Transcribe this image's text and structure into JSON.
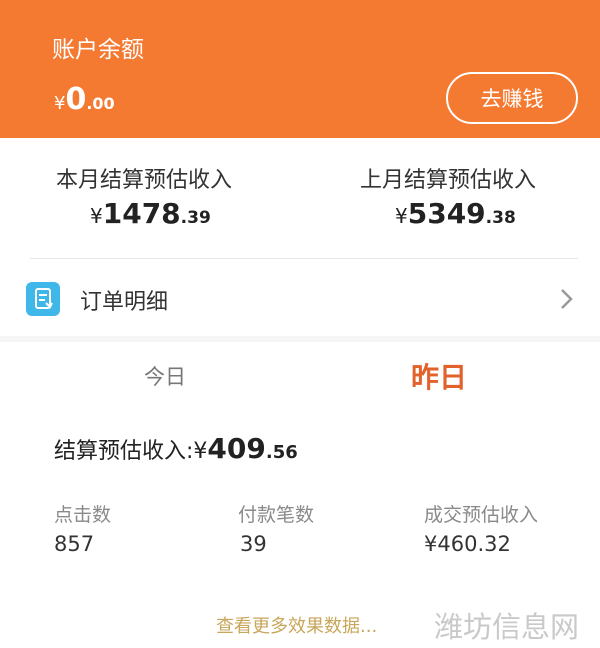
{
  "account": {
    "title": "账户余额",
    "currency": "¥",
    "amount_int": "0",
    "amount_dec": ".00",
    "earn_button": "去赚钱"
  },
  "monthly": {
    "this_month": {
      "label": "本月结算预估收入",
      "currency": "¥",
      "int": "1478",
      "dec": ".39"
    },
    "last_month": {
      "label": "上月结算预估收入",
      "currency": "¥",
      "int": "5349",
      "dec": ".38"
    }
  },
  "orders": {
    "label": "订单明细",
    "icon": "order-document-icon",
    "chevron": "chevron-right-icon"
  },
  "tabs": [
    {
      "label": "今日",
      "active": false
    },
    {
      "label": "昨日",
      "active": true
    }
  ],
  "settlement": {
    "label": "结算预估收入:",
    "currency": "¥",
    "int": "409",
    "dec": ".56"
  },
  "stats": [
    {
      "label": "点击数",
      "value": "857"
    },
    {
      "label": "付款笔数",
      "value": "39"
    },
    {
      "label": "成交预估收入",
      "value": "¥460.32"
    }
  ],
  "more_link": "查看更多效果数据...",
  "watermark": "潍坊信息网",
  "colors": {
    "header_bg": "#f47a32",
    "active_tab": "#e2622b",
    "link": "#c8a65a",
    "icon_bg": "#3fb7e8"
  }
}
